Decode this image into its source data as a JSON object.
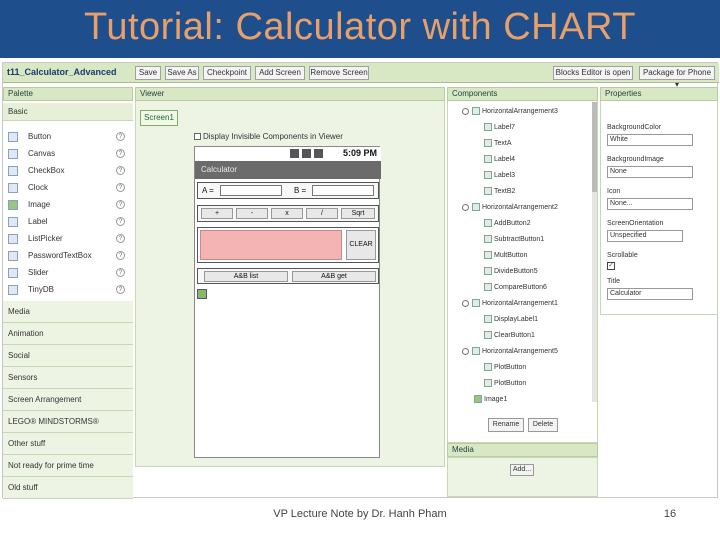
{
  "slide": {
    "title": "Tutorial: Calculator with CHART",
    "footer": "VP Lecture Note by Dr. Hanh Pham",
    "page_number": "16",
    "colors": {
      "title_bar": "#1f4e8c",
      "title_text": "#e8a06a",
      "panel_green": "#d9e8c4"
    }
  },
  "toolbar": {
    "project": "t11_Calculator_Advanced",
    "buttons": [
      "Save",
      "Save As",
      "Checkpoint",
      "Add Screen",
      "Remove Screen"
    ],
    "blocks_editor": "Blocks Editor is open",
    "package": "Package for Phone ▾"
  },
  "palette": {
    "header": "Palette",
    "basic": "Basic",
    "items": [
      "Button",
      "Canvas",
      "CheckBox",
      "Clock",
      "Image",
      "Label",
      "ListPicker",
      "PasswordTextBox",
      "Slider",
      "TinyDB"
    ],
    "sections": [
      "Media",
      "Animation",
      "Social",
      "Sensors",
      "Screen Arrangement",
      "LEGO® MINDSTORMS®",
      "Other stuff",
      "Not ready for prime time",
      "Old stuff"
    ]
  },
  "viewer": {
    "header": "Viewer",
    "screen_tab": "Screen1",
    "display_hidden": "Display Invisible Components in Viewer",
    "status_time": "5:09 PM",
    "app_title": "Calculator",
    "label_a": "A =",
    "label_b": "B =",
    "ops": [
      "+",
      "-",
      "x",
      "/",
      "Sqrt"
    ],
    "clear": "CLEAR",
    "bottom_buttons": [
      "A&B list",
      "A&B get"
    ]
  },
  "components": {
    "header": "Components",
    "tree": [
      {
        "label": "HorizontalArrangement3",
        "toggle": true,
        "indent": 0
      },
      {
        "label": "Label7",
        "indent": 1
      },
      {
        "label": "TextA",
        "indent": 1
      },
      {
        "label": "Label4",
        "indent": 1
      },
      {
        "label": "Label3",
        "indent": 1
      },
      {
        "label": "TextB2",
        "indent": 1
      },
      {
        "label": "HorizontalArrangement2",
        "toggle": true,
        "indent": 0
      },
      {
        "label": "AddButton2",
        "indent": 1
      },
      {
        "label": "SubtractButton1",
        "indent": 1
      },
      {
        "label": "MultButton",
        "indent": 1
      },
      {
        "label": "DivideButton5",
        "indent": 1
      },
      {
        "label": "CompareButton6",
        "indent": 1
      },
      {
        "label": "HorizontalArrangement1",
        "toggle": true,
        "indent": 0
      },
      {
        "label": "DisplayLabel1",
        "indent": 1
      },
      {
        "label": "ClearButton1",
        "indent": 1
      },
      {
        "label": "HorizontalArrangement5",
        "toggle": true,
        "indent": 0
      },
      {
        "label": "PlotButton",
        "indent": 1
      },
      {
        "label": "PlotButton",
        "indent": 1
      },
      {
        "label": "Image1",
        "indent": 0
      }
    ],
    "rename": "Rename",
    "delete": "Delete"
  },
  "media": {
    "header": "Media",
    "add": "Add..."
  },
  "properties": {
    "header": "Properties",
    "fields": [
      {
        "label": "BackgroundColor",
        "value": "White"
      },
      {
        "label": "BackgroundImage",
        "value": "None"
      },
      {
        "label": "Icon",
        "value": "None..."
      },
      {
        "label": "ScreenOrientation",
        "value": "Unspecified"
      },
      {
        "label": "Scrollable",
        "value": "✓",
        "checkbox": true
      },
      {
        "label": "Title",
        "value": "Calculator"
      }
    ]
  }
}
